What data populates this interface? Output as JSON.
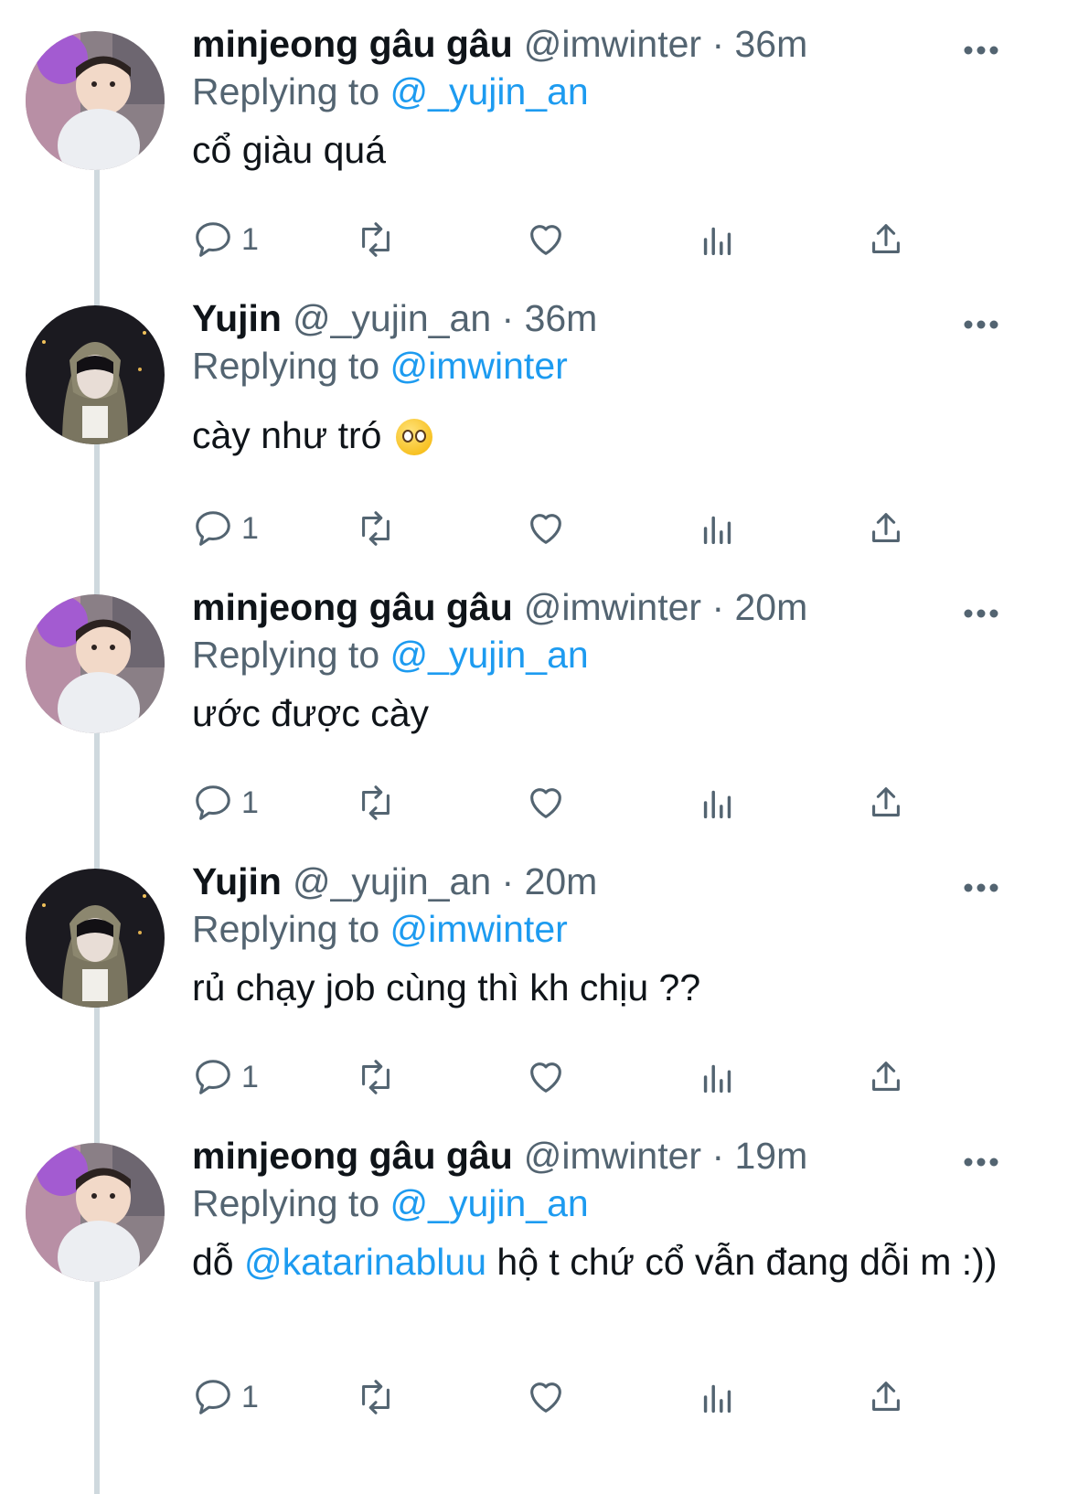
{
  "theme": {
    "accent": "#1d9bf0",
    "secondary_text": "#536471",
    "primary_text": "#0f1419",
    "thread_line": "#cfd9de"
  },
  "tweets": [
    {
      "author": "minjeong gâu gâu",
      "handle": "@imwinter",
      "time": "36m",
      "replying_prefix": "Replying to",
      "replying_to": "@_yujin_an",
      "text": "cổ giàu quá",
      "reply_count": "1",
      "avatar": "minjeong-avatar"
    },
    {
      "author": "Yujin",
      "handle": "@_yujin_an",
      "time": "36m",
      "replying_prefix": "Replying to",
      "replying_to": "@imwinter",
      "text": "cày như tró",
      "emoji": "pleading-face-emoji",
      "reply_count": "1",
      "avatar": "yujin-avatar"
    },
    {
      "author": "minjeong gâu gâu",
      "handle": "@imwinter",
      "time": "20m",
      "replying_prefix": "Replying to",
      "replying_to": "@_yujin_an",
      "text": "ước được cày",
      "reply_count": "1",
      "avatar": "minjeong-avatar"
    },
    {
      "author": "Yujin",
      "handle": "@_yujin_an",
      "time": "20m",
      "replying_prefix": "Replying to",
      "replying_to": "@imwinter",
      "text": "rủ chạy job cùng thì kh chịu ??",
      "reply_count": "1",
      "avatar": "yujin-avatar"
    },
    {
      "author": "minjeong gâu gâu",
      "handle": "@imwinter",
      "time": "19m",
      "replying_prefix": "Replying to",
      "replying_to": "@_yujin_an",
      "text_before": "dỗ",
      "text_mention": "@katarinabluu",
      "text_after": "hộ t chứ cổ vẫn đang dỗi m :))",
      "reply_count": "1",
      "avatar": "minjeong-avatar"
    }
  ],
  "icons": [
    "more-icon",
    "reply-icon",
    "retweet-icon",
    "like-icon",
    "views-icon",
    "share-icon"
  ]
}
